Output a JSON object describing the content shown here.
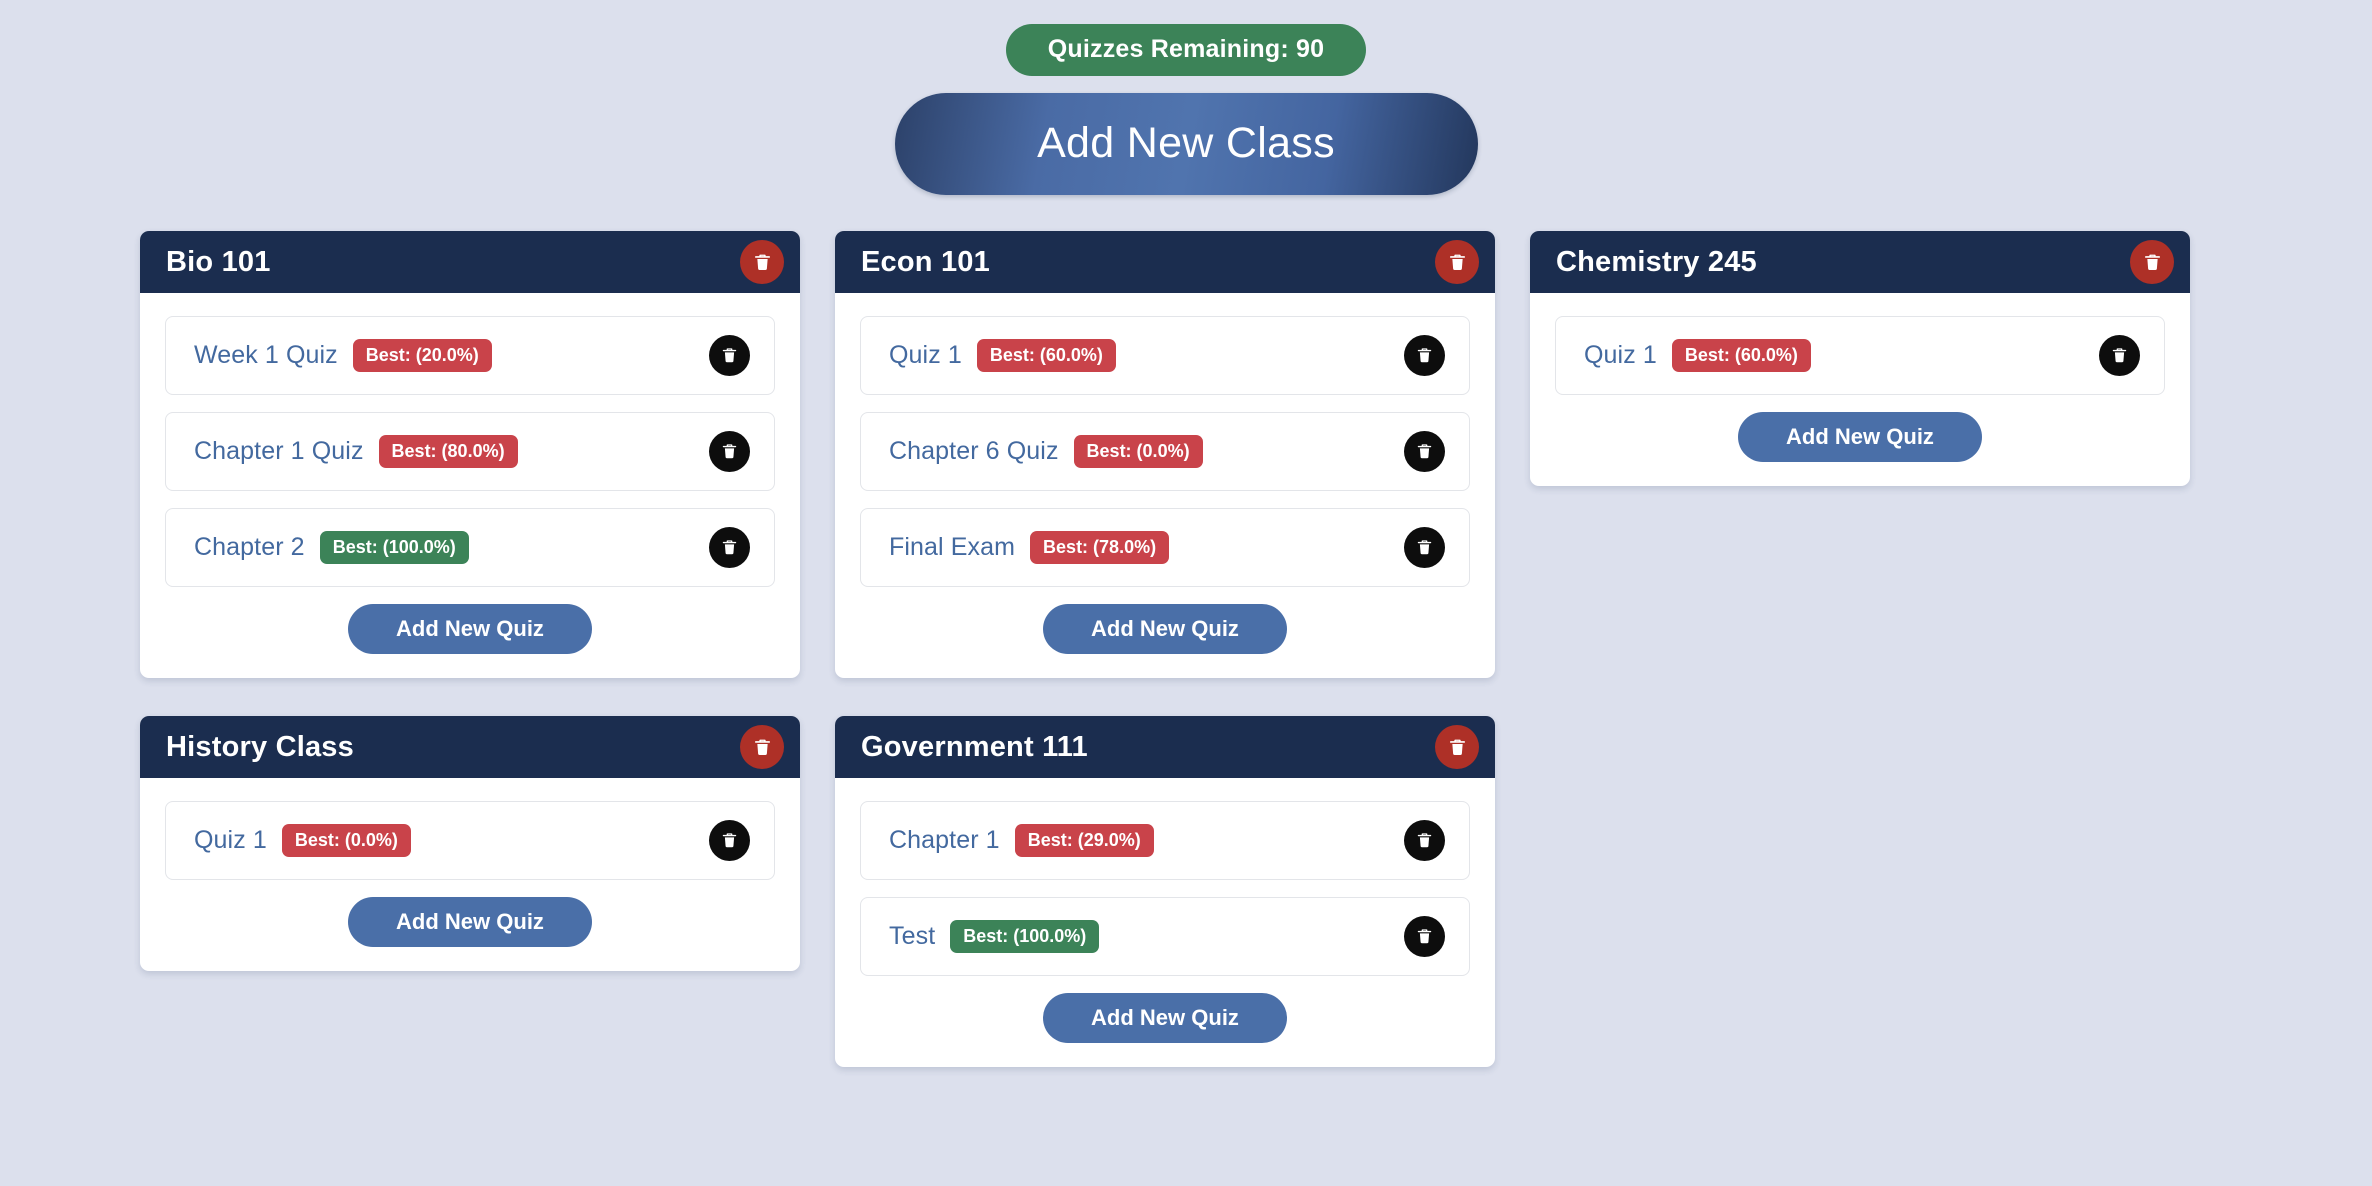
{
  "header": {
    "quiz_counter_label": "Quizzes Remaining: 90",
    "add_class_label": "Add New Class"
  },
  "labels": {
    "add_quiz_label": "Add New Quiz"
  },
  "colors": {
    "background": "#dce0ed",
    "card_header": "#1b2d4f",
    "accent_blue": "#4a6fa8",
    "link_blue": "#43699f",
    "badge_low": "#c9434a",
    "badge_high": "#3c8358",
    "delete_class": "#ae3027",
    "delete_quiz": "#0d0d0d"
  },
  "icons": {
    "trash": "trash-icon"
  },
  "classes": [
    {
      "name": "Bio 101",
      "quizzes": [
        {
          "name": "Week 1 Quiz",
          "best_label": "Best: (20.0%)",
          "best_value": 20.0,
          "status": "low"
        },
        {
          "name": "Chapter 1 Quiz",
          "best_label": "Best: (80.0%)",
          "best_value": 80.0,
          "status": "low"
        },
        {
          "name": "Chapter 2",
          "best_label": "Best: (100.0%)",
          "best_value": 100.0,
          "status": "high"
        }
      ]
    },
    {
      "name": "Econ 101",
      "quizzes": [
        {
          "name": "Quiz 1",
          "best_label": "Best: (60.0%)",
          "best_value": 60.0,
          "status": "low"
        },
        {
          "name": "Chapter 6 Quiz",
          "best_label": "Best: (0.0%)",
          "best_value": 0.0,
          "status": "low"
        },
        {
          "name": "Final Exam",
          "best_label": "Best: (78.0%)",
          "best_value": 78.0,
          "status": "low"
        }
      ]
    },
    {
      "name": "Chemistry 245",
      "quizzes": [
        {
          "name": "Quiz 1",
          "best_label": "Best: (60.0%)",
          "best_value": 60.0,
          "status": "low"
        }
      ]
    },
    {
      "name": "History Class",
      "quizzes": [
        {
          "name": "Quiz 1",
          "best_label": "Best: (0.0%)",
          "best_value": 0.0,
          "status": "low"
        }
      ]
    },
    {
      "name": "Government 111",
      "quizzes": [
        {
          "name": "Chapter 1",
          "best_label": "Best: (29.0%)",
          "best_value": 29.0,
          "status": "low"
        },
        {
          "name": "Test",
          "best_label": "Best: (100.0%)",
          "best_value": 100.0,
          "status": "high"
        }
      ]
    }
  ]
}
